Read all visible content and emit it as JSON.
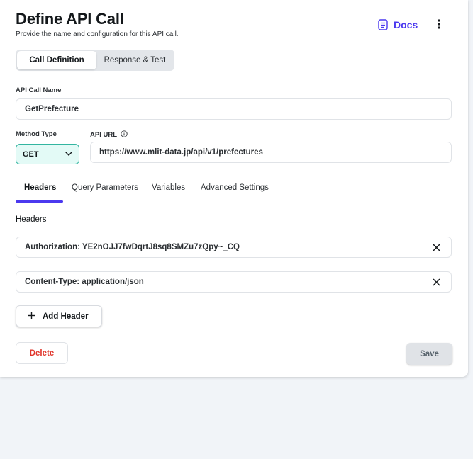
{
  "header": {
    "title": "Define API Call",
    "subtitle": "Provide the name and configuration for this API call.",
    "docs_label": "Docs",
    "docs_icon": "document-icon",
    "more_icon": "more-vertical-icon"
  },
  "segments": [
    {
      "label": "Call Definition",
      "active": true
    },
    {
      "label": "Response & Test",
      "active": false
    }
  ],
  "form": {
    "api_call_name": {
      "label": "API Call Name",
      "value": "GetPrefecture"
    },
    "method_type": {
      "label": "Method Type",
      "value": "GET"
    },
    "api_url": {
      "label": "API URL",
      "value": "https://www.mlit-data.jp/api/v1/prefectures",
      "info_icon": "info-icon"
    }
  },
  "tabs": [
    {
      "label": "Headers",
      "active": true
    },
    {
      "label": "Query Parameters",
      "active": false
    },
    {
      "label": "Variables",
      "active": false
    },
    {
      "label": "Advanced Settings",
      "active": false
    }
  ],
  "headers_section": {
    "title": "Headers",
    "items": [
      {
        "value": "Authorization: YE2nOJJ7fwDqrtJ8sq8SMZu7zQpy~_CQ"
      },
      {
        "value": "Content-Type: application/json"
      }
    ],
    "add_label": "Add Header"
  },
  "footer": {
    "delete_label": "Delete",
    "save_label": "Save"
  },
  "colors": {
    "accent": "#4b39ef",
    "danger": "#e0352b",
    "method_bg": "#e3faf6",
    "method_border": "#33b5a0",
    "page_bg": "#f1f4f8"
  }
}
